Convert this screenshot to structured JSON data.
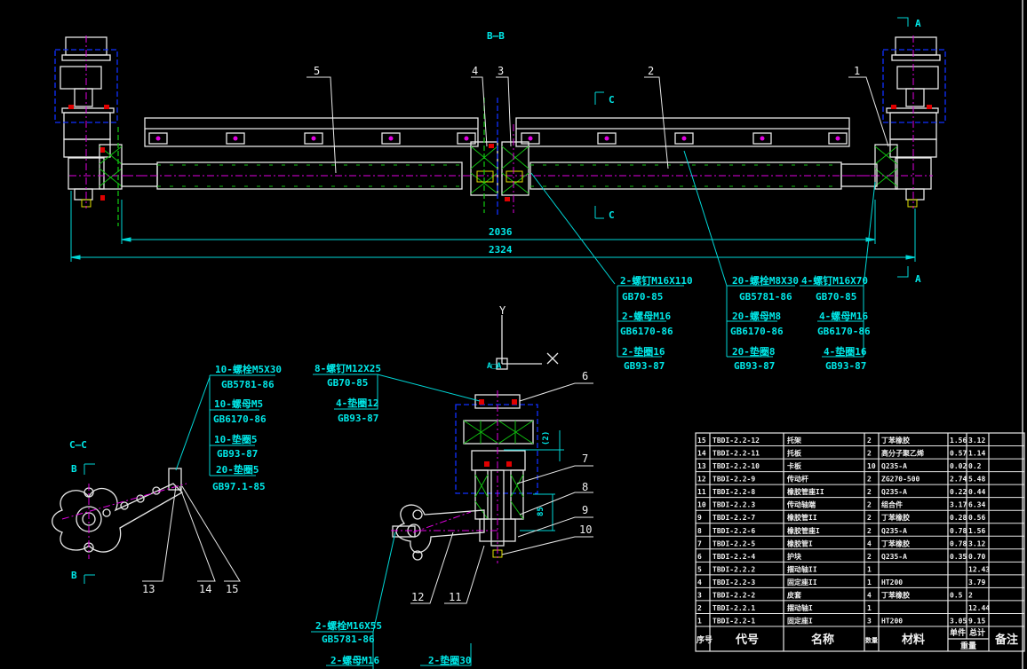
{
  "colors": {
    "background": "#000000",
    "outline": "#e8e8e8",
    "dimension": "#00d8d8",
    "centerline": "#e000e0",
    "hidden": "#1030ff",
    "rubber_hatch": "#10c010",
    "bolt": "#e00000"
  },
  "top_view": {
    "section_bb": "B—B",
    "section_c_top": "C",
    "section_c_bottom": "C",
    "section_a_top": "A",
    "section_a_bottom": "A",
    "parts": [
      "5",
      "4",
      "3",
      "2",
      "1"
    ],
    "dim_inner": "2036",
    "dim_outer": "2324",
    "callouts": [
      {
        "lines": [
          "2-螺钉M16X110",
          "GB70-85",
          "2-螺母M16",
          "GB6170-86",
          "2-垫圈16",
          "GB93-87"
        ]
      },
      {
        "lines": [
          "20-螺栓M8X30",
          "GB5781-86",
          "20-螺母M8",
          "GB6170-86",
          "20-垫圈8",
          "GB93-87"
        ]
      },
      {
        "lines": [
          "4-螺钉M16X70",
          "GB70-85",
          "4-螺母M16",
          "GB6170-86",
          "4-垫圈16",
          "GB93-87"
        ]
      }
    ]
  },
  "section_cc": {
    "title": "C—C",
    "marker_top": "B",
    "marker_bottom": "B",
    "parts": [
      "13",
      "14",
      "15"
    ],
    "callout": {
      "lines": [
        "10-螺栓M5X30",
        "GB5781-86",
        "10-螺母M5",
        "GB6170-86",
        "10-垫圈5",
        "GB93-87",
        "20-垫圈5",
        "GB97.1-85"
      ]
    }
  },
  "section_aa": {
    "ucs_y": "Y",
    "ucs_x": "X",
    "title": "A□A",
    "parts": [
      "6",
      "7",
      "8",
      "9",
      "10",
      "11",
      "12"
    ],
    "callout_top": {
      "lines": [
        "8-螺钉M12X25",
        "GB70-85",
        "4-垫圈12",
        "GB93-87"
      ]
    },
    "callout_bottom": {
      "lines": [
        "2-螺栓M16X55",
        "GB5781-86",
        "2-螺母M16"
      ]
    },
    "callout_washer": "2-垫圈30",
    "dim_vertical": "85",
    "dim_small": "(2)"
  },
  "parts_list": {
    "headers": {
      "no": "序号",
      "code": "代号",
      "name": "名称",
      "qty": "数量",
      "material": "材料",
      "unit": "单件",
      "total": "总计",
      "weight": "重量",
      "remark": "备注"
    },
    "rows": [
      {
        "no": "15",
        "code": "TBDI-2.2-12",
        "name": "托架",
        "qty": "2",
        "material": "丁苯橡胶",
        "unit": "1.56",
        "total": "3.12"
      },
      {
        "no": "14",
        "code": "TBDI-2.2-11",
        "name": "托板",
        "qty": "2",
        "material": "高分子聚乙烯",
        "unit": "0.57",
        "total": "1.14"
      },
      {
        "no": "13",
        "code": "TBDI-2.2-10",
        "name": "卡板",
        "qty": "10",
        "material": "Q235-A",
        "unit": "0.02",
        "total": "0.2"
      },
      {
        "no": "12",
        "code": "TBDI-2.2-9",
        "name": "传动杆",
        "qty": "2",
        "material": "ZG270-500",
        "unit": "2.74",
        "total": "5.48"
      },
      {
        "no": "11",
        "code": "TBDI-2.2-8",
        "name": "橡胶管座II",
        "qty": "2",
        "material": "Q235-A",
        "unit": "0.22",
        "total": "0.44"
      },
      {
        "no": "10",
        "code": "TBDI-2.2.3",
        "name": "传动轴端",
        "qty": "2",
        "material": "组合件",
        "unit": "3.17",
        "total": "6.34"
      },
      {
        "no": "9",
        "code": "TBDI-2.2-7",
        "name": "橡胶管II",
        "qty": "2",
        "material": "丁苯橡胶",
        "unit": "0.28",
        "total": "0.56"
      },
      {
        "no": "8",
        "code": "TBDI-2.2-6",
        "name": "橡胶管座I",
        "qty": "2",
        "material": "Q235-A",
        "unit": "0.78",
        "total": "1.56"
      },
      {
        "no": "7",
        "code": "TBDI-2.2-5",
        "name": "橡胶管I",
        "qty": "4",
        "material": "丁苯橡胶",
        "unit": "0.78",
        "total": "3.12"
      },
      {
        "no": "6",
        "code": "TBDI-2.2-4",
        "name": "护块",
        "qty": "2",
        "material": "Q235-A",
        "unit": "0.35",
        "total": "0.70"
      },
      {
        "no": "5",
        "code": "TBDI-2.2.2",
        "name": "摆动轴II",
        "qty": "1",
        "material": "",
        "unit": "",
        "total": "12.43"
      },
      {
        "no": "4",
        "code": "TBDI-2.2-3",
        "name": "固定座II",
        "qty": "1",
        "material": "HT200",
        "unit": "",
        "total": "3.79"
      },
      {
        "no": "3",
        "code": "TBDI-2.2-2",
        "name": "皮套",
        "qty": "4",
        "material": "丁苯橡胶",
        "unit": "0.5",
        "total": "2"
      },
      {
        "no": "2",
        "code": "TBDI-2.2.1",
        "name": "摆动轴I",
        "qty": "1",
        "material": "",
        "unit": "",
        "total": "12.44"
      },
      {
        "no": "1",
        "code": "TBDI-2.2-1",
        "name": "固定座I",
        "qty": "3",
        "material": "HT200",
        "unit": "3.05",
        "total": "9.15"
      }
    ]
  }
}
